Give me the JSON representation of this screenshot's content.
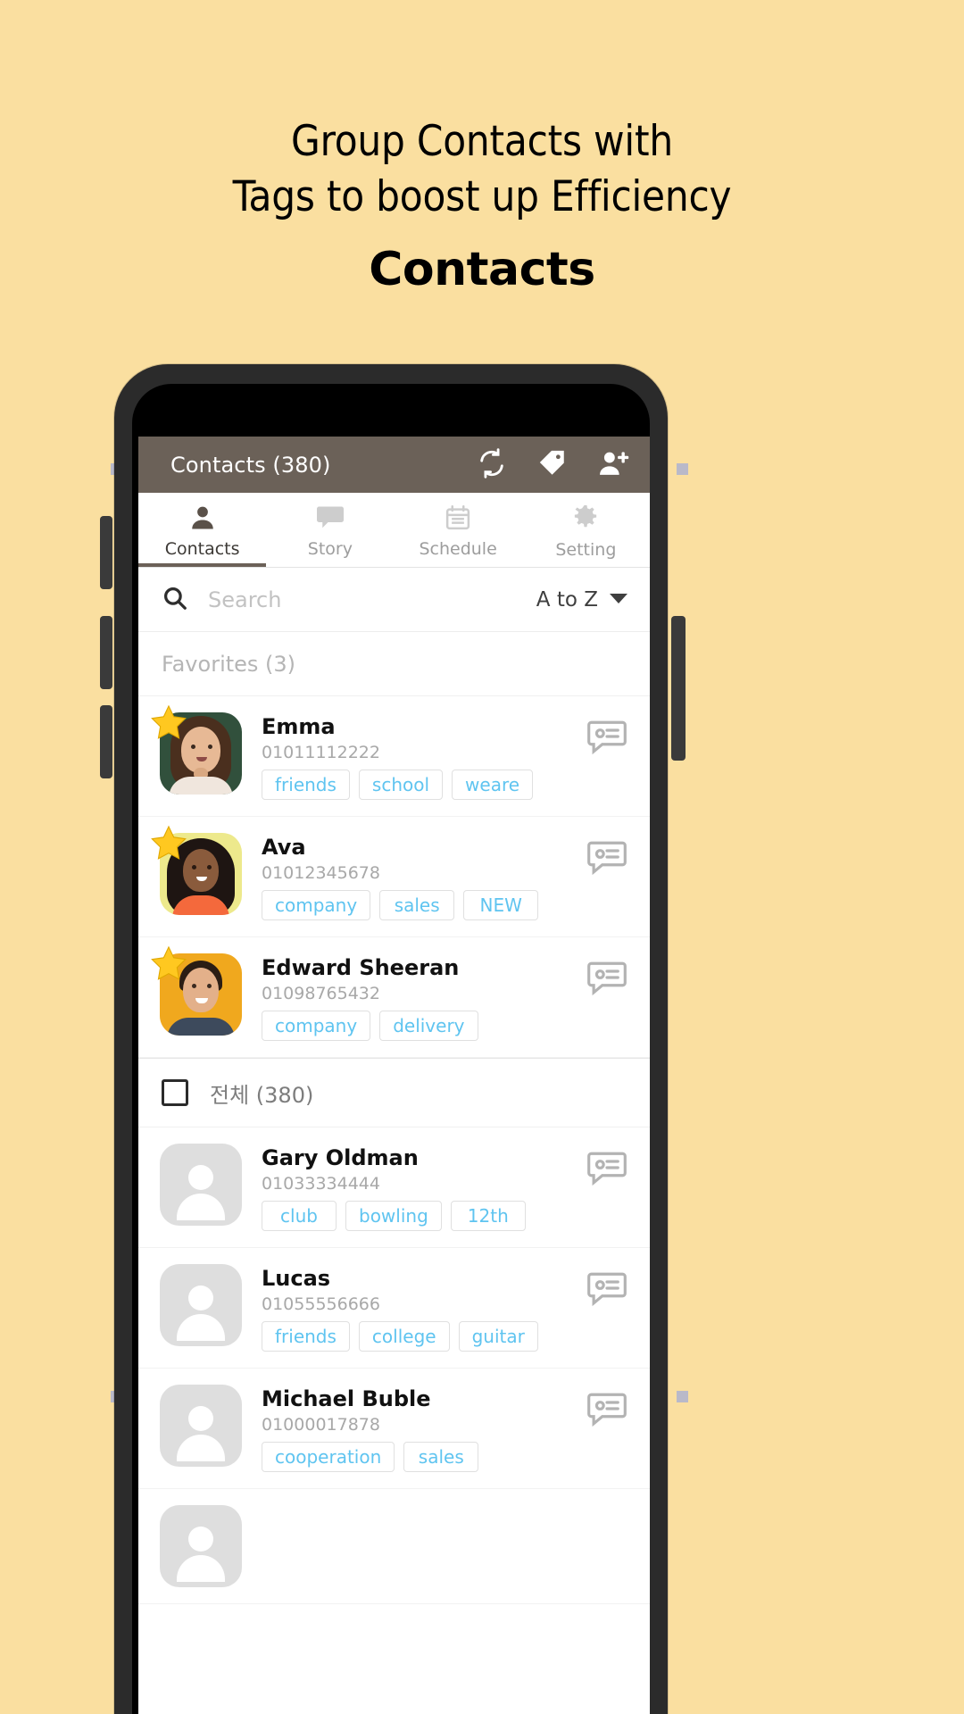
{
  "promo": {
    "headline_line1": "Group Contacts with",
    "headline_line2": "Tags to boost up Efficiency",
    "subtitle": "Contacts"
  },
  "app": {
    "appbar": {
      "title": "Contacts (380)",
      "icons": [
        "sync-icon",
        "tag-icon",
        "add-person-icon"
      ]
    },
    "tabs": [
      {
        "label": "Contacts",
        "icon": "person-icon",
        "active": true
      },
      {
        "label": "Story",
        "icon": "chat-bubble-icon",
        "active": false
      },
      {
        "label": "Schedule",
        "icon": "calendar-icon",
        "active": false
      },
      {
        "label": "Setting",
        "icon": "gear-icon",
        "active": false
      }
    ],
    "search": {
      "placeholder": "Search",
      "sort_label": "A to Z",
      "sort_icon": "chevron-down-icon",
      "search_icon": "search-icon"
    },
    "sections": [
      {
        "title": "Favorites (3)",
        "has_checkbox": false
      },
      {
        "title": "전체 (380)",
        "has_checkbox": true
      }
    ],
    "favorites": [
      {
        "name": "Emma",
        "phone": "01011112222",
        "tags": [
          "friends",
          "school",
          "weare"
        ],
        "starred": true,
        "avatar": "photo-emma"
      },
      {
        "name": "Ava",
        "phone": "01012345678",
        "tags": [
          "company",
          "sales",
          "NEW"
        ],
        "starred": true,
        "avatar": "photo-ava"
      },
      {
        "name": "Edward Sheeran",
        "phone": "01098765432",
        "tags": [
          "company",
          "delivery"
        ],
        "starred": true,
        "avatar": "photo-edward"
      }
    ],
    "all_contacts": [
      {
        "name": "Gary Oldman",
        "phone": "01033334444",
        "tags": [
          "club",
          "bowling",
          "12th"
        ],
        "starred": false,
        "avatar": "placeholder-avatar"
      },
      {
        "name": "Lucas",
        "phone": "01055556666",
        "tags": [
          "friends",
          "college",
          "guitar"
        ],
        "starred": false,
        "avatar": "placeholder-avatar"
      },
      {
        "name": "Michael Buble",
        "phone": "01000017878",
        "tags": [
          "cooperation",
          "sales"
        ],
        "starred": false,
        "avatar": "placeholder-avatar"
      }
    ],
    "row_action_icon": "message-icon"
  },
  "colors": {
    "background": "#FADFA0",
    "appbar": "#6B6158",
    "tag_text": "#5FC4F0",
    "star": "#FFC820",
    "placeholder_avatar": "#DEDEDE"
  }
}
